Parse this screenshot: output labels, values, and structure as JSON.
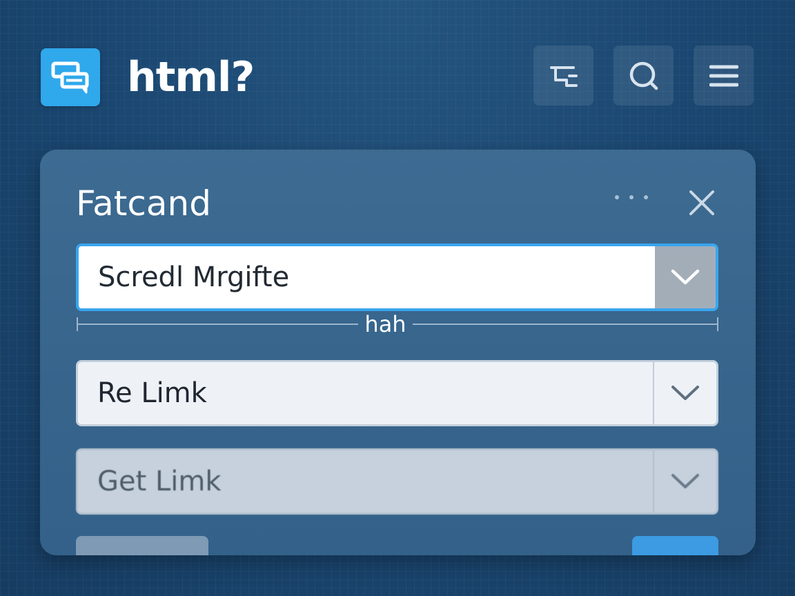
{
  "header": {
    "app_title": "html?",
    "logo_icon": "chat-bubbles-icon",
    "actions": [
      {
        "icon": "route-icon"
      },
      {
        "icon": "search-icon"
      },
      {
        "icon": "menu-icon"
      }
    ]
  },
  "panel": {
    "title": "Fatcand",
    "more_icon": "more-dots-icon",
    "close_icon": "close-icon",
    "fields": [
      {
        "value": "Scredl Mrgifte",
        "state": "focused"
      },
      {
        "value": "Re Limk",
        "state": "normal"
      },
      {
        "value": "Get Limk",
        "state": "disabled"
      }
    ],
    "measure_label": "hah"
  },
  "colors": {
    "background": "#1a4670",
    "panel": "#3a6890",
    "accent": "#2fa8ec",
    "focus_border": "#3aa5ee",
    "primary_button": "#3c9be2"
  }
}
